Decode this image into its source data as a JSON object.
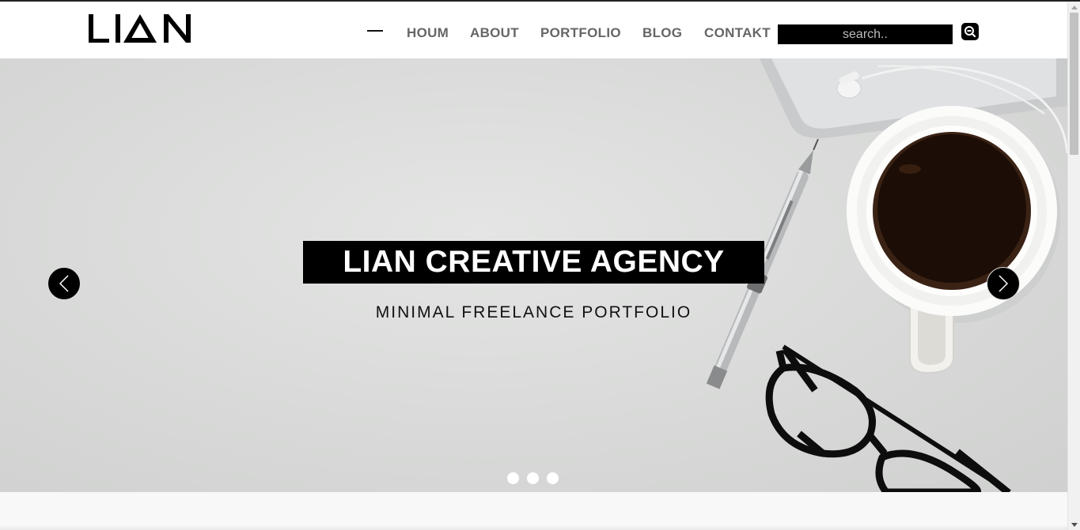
{
  "header": {
    "logo_text": "LIAN",
    "nav": {
      "houm": "HOUM",
      "about": "ABOUT",
      "portfolio": "PORTFOLIO",
      "blog": "BLOG",
      "contakt": "CONTAKT"
    },
    "menu_icon": "menu-dash-icon",
    "search": {
      "placeholder": "search..",
      "value": "",
      "icon": "search-icon"
    }
  },
  "hero": {
    "title": "LIAN CREATIVE AGENCY",
    "subtitle": "MINIMAL FREELANCE PORTFOLIO",
    "prev_icon": "chevron-left-icon",
    "next_icon": "chevron-right-icon",
    "slide_count": 3,
    "background_color": "#dadbda"
  },
  "colors": {
    "title_box": "#000000",
    "nav_text": "#666666",
    "dot": "#ffffff"
  }
}
